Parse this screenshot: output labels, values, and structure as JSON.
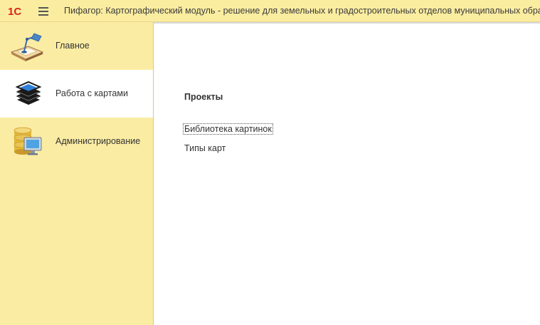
{
  "header": {
    "logo_text": "1С",
    "title": "Пифагор: Картографический модуль - решение для земельных и градостроительных отделов муниципальных образований"
  },
  "sidebar": {
    "items": [
      {
        "label": "Главное",
        "icon": "desk-lamp-icon",
        "active": false
      },
      {
        "label": "Работа с картами",
        "icon": "layers-icon",
        "active": true
      },
      {
        "label": "Администрирование",
        "icon": "database-computer-icon",
        "active": false
      }
    ]
  },
  "main": {
    "section_title": "Проекты",
    "links": [
      {
        "label": "Библиотека картинок",
        "focused": true
      },
      {
        "label": "Типы карт",
        "focused": false
      }
    ]
  },
  "colors": {
    "header_bg": "#fbeda0",
    "sidebar_bg": "#fbeca3",
    "active_item_bg": "#ffffff",
    "logo_red": "#d9241c"
  }
}
